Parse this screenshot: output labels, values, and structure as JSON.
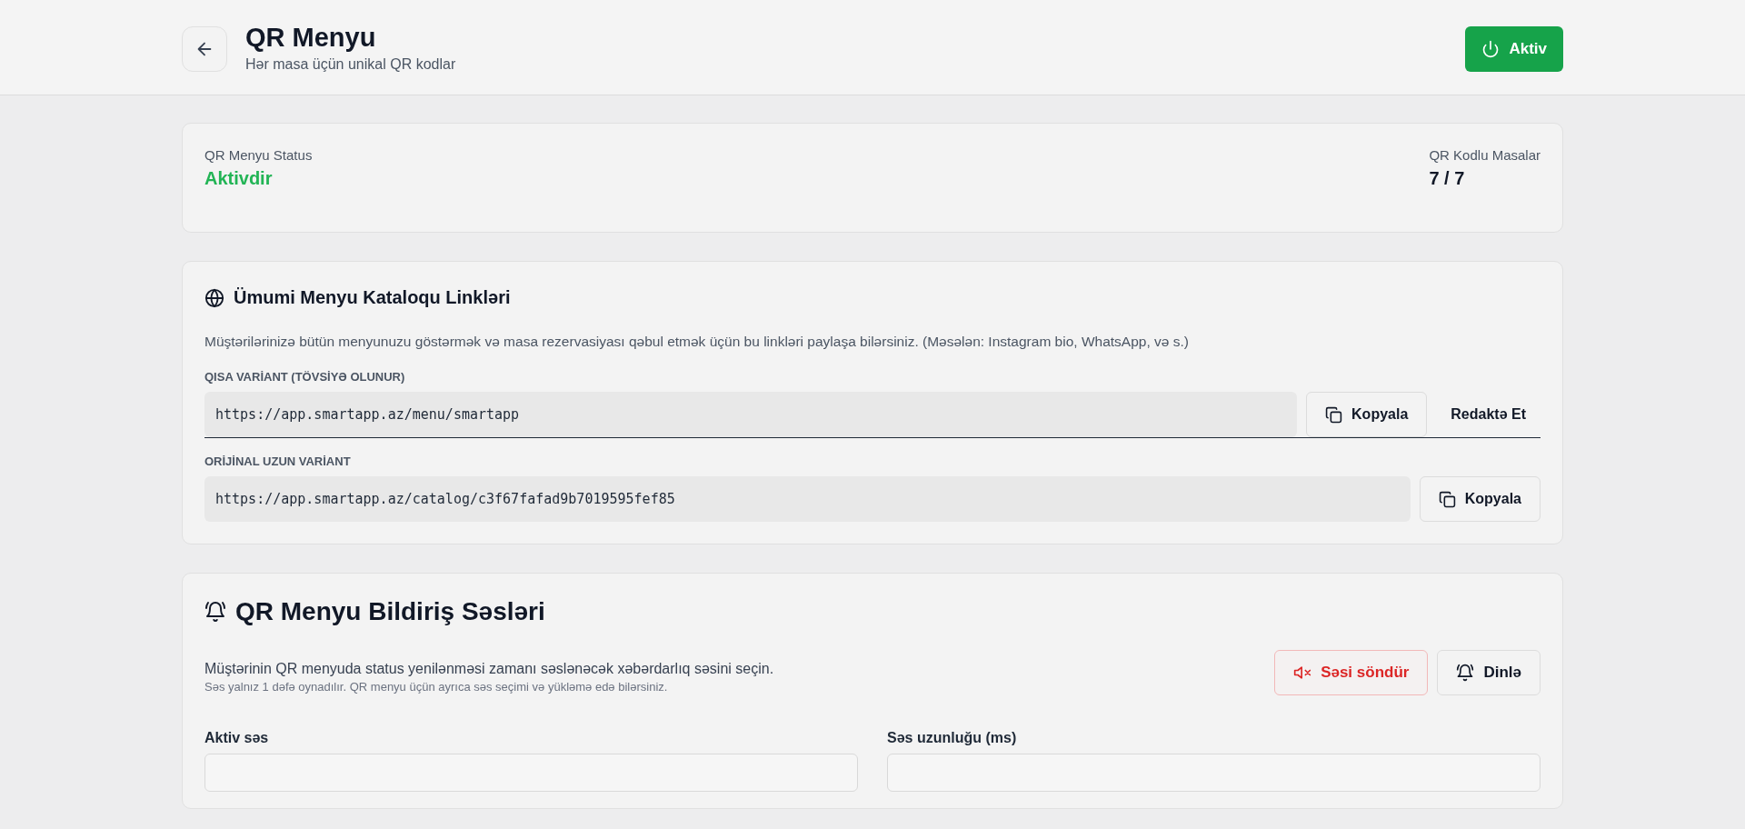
{
  "header": {
    "title": "QR Menyu",
    "subtitle": "Hər masa üçün unikal QR kodlar",
    "toggle": {
      "label": "Aktiv",
      "on": true
    }
  },
  "status_card": {
    "status_label": "QR Menyu Status",
    "status_value": "Aktivdir",
    "active": true,
    "tables_label": "QR Kodlu Masalar",
    "tables_value": "7 / 7"
  },
  "links_card": {
    "title": "Ümumi Menyu Kataloqu Linkləri",
    "description": "Müştərilərinizə bütün menyunuzu göstərmək və masa rezervasiyası qəbul etmək üçün bu linkləri paylaşa bilərsiniz. (Məsələn: Instagram bio, WhatsApp, və s.)",
    "links": [
      {
        "label": "QISA VARİANT (TÖVSİYƏ OLUNUR)",
        "url": "https://app.smartapp.az/menu/smartapp",
        "buttons": [
          {
            "kind": "copy",
            "label": "Kopyala"
          },
          {
            "kind": "edit",
            "label": "Redaktə Et"
          }
        ]
      },
      {
        "label": "ORİJİNAL UZUN VARİANT",
        "url": "https://app.smartapp.az/catalog/c3f67fafad9b7019595fef85",
        "buttons": [
          {
            "kind": "copy",
            "label": "Kopyala"
          }
        ]
      }
    ]
  },
  "sound_card": {
    "title": "QR Menyu Bildiriş Səsləri",
    "description": "Müştərinin QR menyuda status yenilənməsi zamanı səslənəcək xəbərdarlıq səsini seçin.",
    "note": "Səs yalnız 1 dəfə oynadılır. QR menyu üçün ayrıca səs seçimi və yükləmə edə bilərsiniz.",
    "actions": [
      {
        "kind": "mute",
        "label": "Səsi söndür"
      },
      {
        "kind": "listen",
        "label": "Dinlə"
      }
    ],
    "fields": [
      {
        "label": "Aktiv səs"
      },
      {
        "label": "Səs uzunluğu (ms)"
      }
    ]
  }
}
